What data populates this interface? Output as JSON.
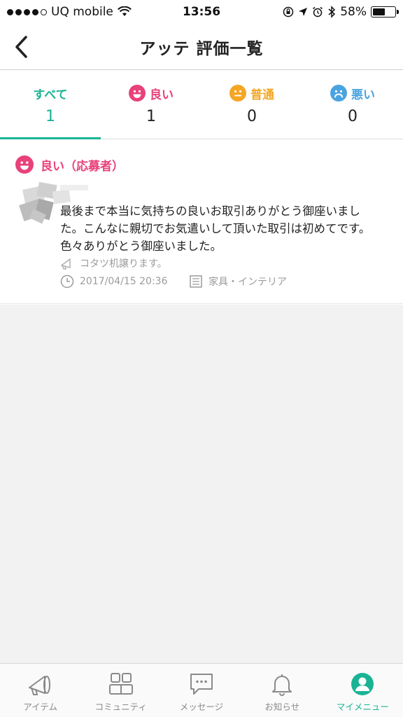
{
  "status_bar": {
    "carrier": "UQ mobile",
    "time": "13:56",
    "battery": "58%",
    "battery_level": 0.58
  },
  "nav": {
    "title": "アッテ 評価一覧"
  },
  "tabs": [
    {
      "label": "すべて",
      "count": "1",
      "icon": "",
      "active": true
    },
    {
      "label": "良い",
      "count": "1",
      "icon": "smile-face-icon",
      "color": "#e9417a"
    },
    {
      "label": "普通",
      "count": "0",
      "icon": "neutral-face-icon",
      "color": "#f5a623"
    },
    {
      "label": "悪い",
      "count": "0",
      "icon": "sad-face-icon",
      "color": "#4aa3df"
    }
  ],
  "review": {
    "rating": "良い（応募者）",
    "rating_color": "#e9417a",
    "text_lines": [
      "最後まで本当に気持ちの良いお取引ありがとう御座いまし",
      "た。こんなに親切でお気遣いして頂いた取引は初めてです。",
      "色々ありがとう御座いました。"
    ],
    "item": "コタツ机譲ります。",
    "date": "2017/04/15 20:36",
    "category": "家具・インテリア"
  },
  "tab_bar": [
    {
      "label": "アイテム",
      "icon": "megaphone-icon"
    },
    {
      "label": "コミュニティ",
      "icon": "community-icon"
    },
    {
      "label": "メッセージ",
      "icon": "message-icon"
    },
    {
      "label": "お知らせ",
      "icon": "bell-icon"
    },
    {
      "label": "マイメニュー",
      "icon": "profile-icon",
      "active": true
    }
  ],
  "colors": {
    "accent": "#1ab394",
    "good": "#e9417a",
    "neutral": "#f5a623",
    "bad": "#4aa3df"
  }
}
